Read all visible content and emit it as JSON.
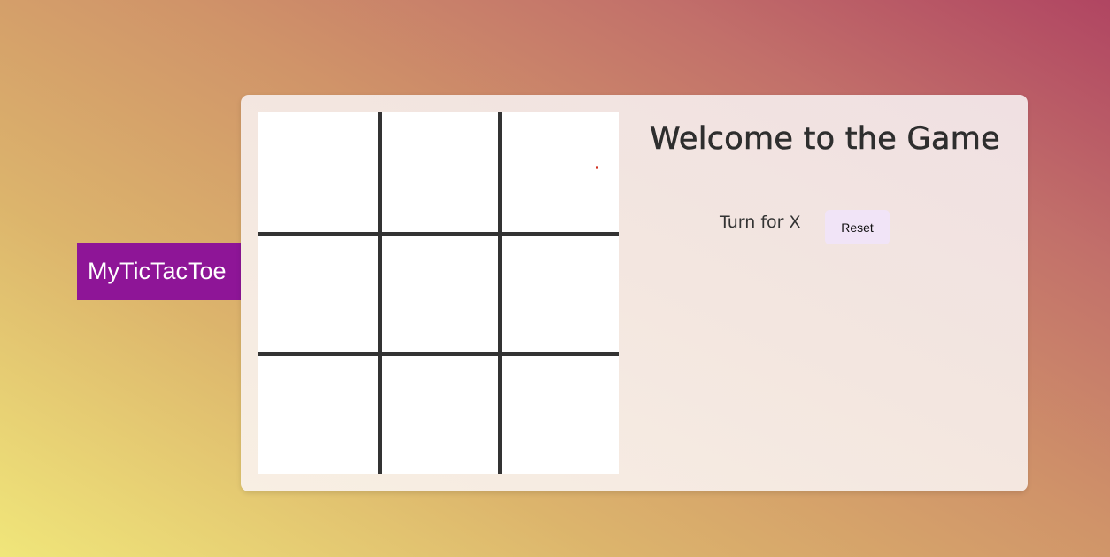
{
  "brand": {
    "label": "MyTicTacToe",
    "color": "#8e1597"
  },
  "game": {
    "title": "Welcome to the Game",
    "turn_text": "Turn for X",
    "reset_label": "Reset",
    "board": [
      "",
      "",
      "",
      "",
      "",
      "",
      "",
      "",
      ""
    ]
  }
}
